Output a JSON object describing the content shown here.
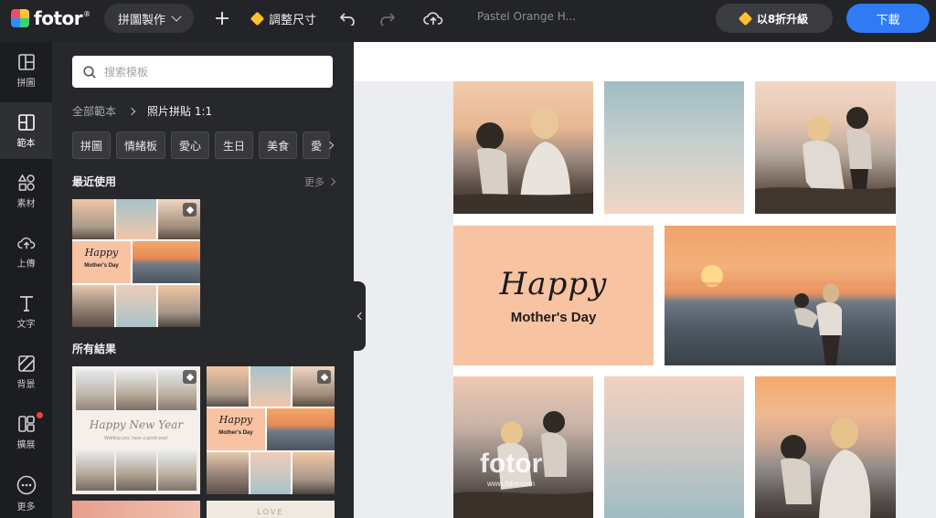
{
  "header": {
    "logo_text": "fotor",
    "logo_mark": "®",
    "mode_label": "拼圖製作",
    "resize_label": "調整尺寸",
    "doc_title": "Pastel Orange H...",
    "upgrade_label": "以8折升級",
    "download_label": "下載",
    "icons": [
      "plus-icon",
      "undo-icon",
      "redo-icon",
      "upload-cloud-icon",
      "diamond-icon"
    ]
  },
  "rail": {
    "items": [
      {
        "label": "拼圖",
        "icon": "collage-icon"
      },
      {
        "label": "範本",
        "icon": "templates-icon",
        "active": true
      },
      {
        "label": "素材",
        "icon": "elements-icon"
      },
      {
        "label": "上傳",
        "icon": "upload-icon"
      },
      {
        "label": "文字",
        "icon": "text-icon"
      },
      {
        "label": "背景",
        "icon": "background-icon"
      },
      {
        "label": "擴展",
        "icon": "apps-icon",
        "badge": true
      },
      {
        "label": "更多",
        "icon": "more-icon"
      }
    ]
  },
  "panel": {
    "search_placeholder": "搜索模板",
    "breadcrumb_root": "全部範本",
    "breadcrumb_current": "照片拼貼 1:1",
    "tags": [
      "拼圖",
      "情緒板",
      "愛心",
      "生日",
      "美食",
      "愛"
    ],
    "recent_title": "最近使用",
    "more_label": "更多",
    "all_results_title": "所有結果",
    "thumb_happy": "Happy",
    "thumb_mothers_day": "Mother's Day",
    "thumb_happy_new_year": "Happy New Year",
    "thumb_new_year_sub": "Wishing you, have a good year!",
    "thumb_love": "LOVE"
  },
  "design": {
    "happy_text": "Happy",
    "mothers_day_text": "Mother's Day",
    "watermark_text": "fotor",
    "watermark_url": "www.fotor.com"
  },
  "colors": {
    "accent": "#2f7bf5",
    "peach": "#f8c3a3",
    "premium": "#ffbf2f",
    "badge": "#ff3b3b"
  }
}
